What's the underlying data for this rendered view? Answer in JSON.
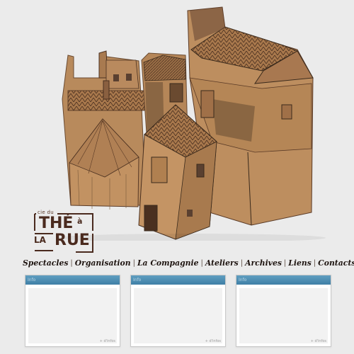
{
  "logo": {
    "top_line": "cie du",
    "word_the": "THÉ",
    "word_a": "à",
    "word_la": "LA",
    "word_rue": "RUE"
  },
  "nav": {
    "items": [
      "Spectacles",
      "Organisation",
      "La Compagnie",
      "Ateliers",
      "Archives",
      "Liens",
      "Contacts"
    ],
    "separator": "|"
  },
  "panels": [
    {
      "header": "Info",
      "footer": "+ d'infos"
    },
    {
      "header": "Info",
      "footer": "+ d'infos"
    },
    {
      "header": "Info",
      "footer": "+ d'infos"
    }
  ],
  "colors": {
    "background": "#ebebeb",
    "cardboard": "#b98a5c",
    "ink": "#3a2a20",
    "panel_header": "#4f8fb5",
    "logo_brown": "#4a2a1e"
  }
}
